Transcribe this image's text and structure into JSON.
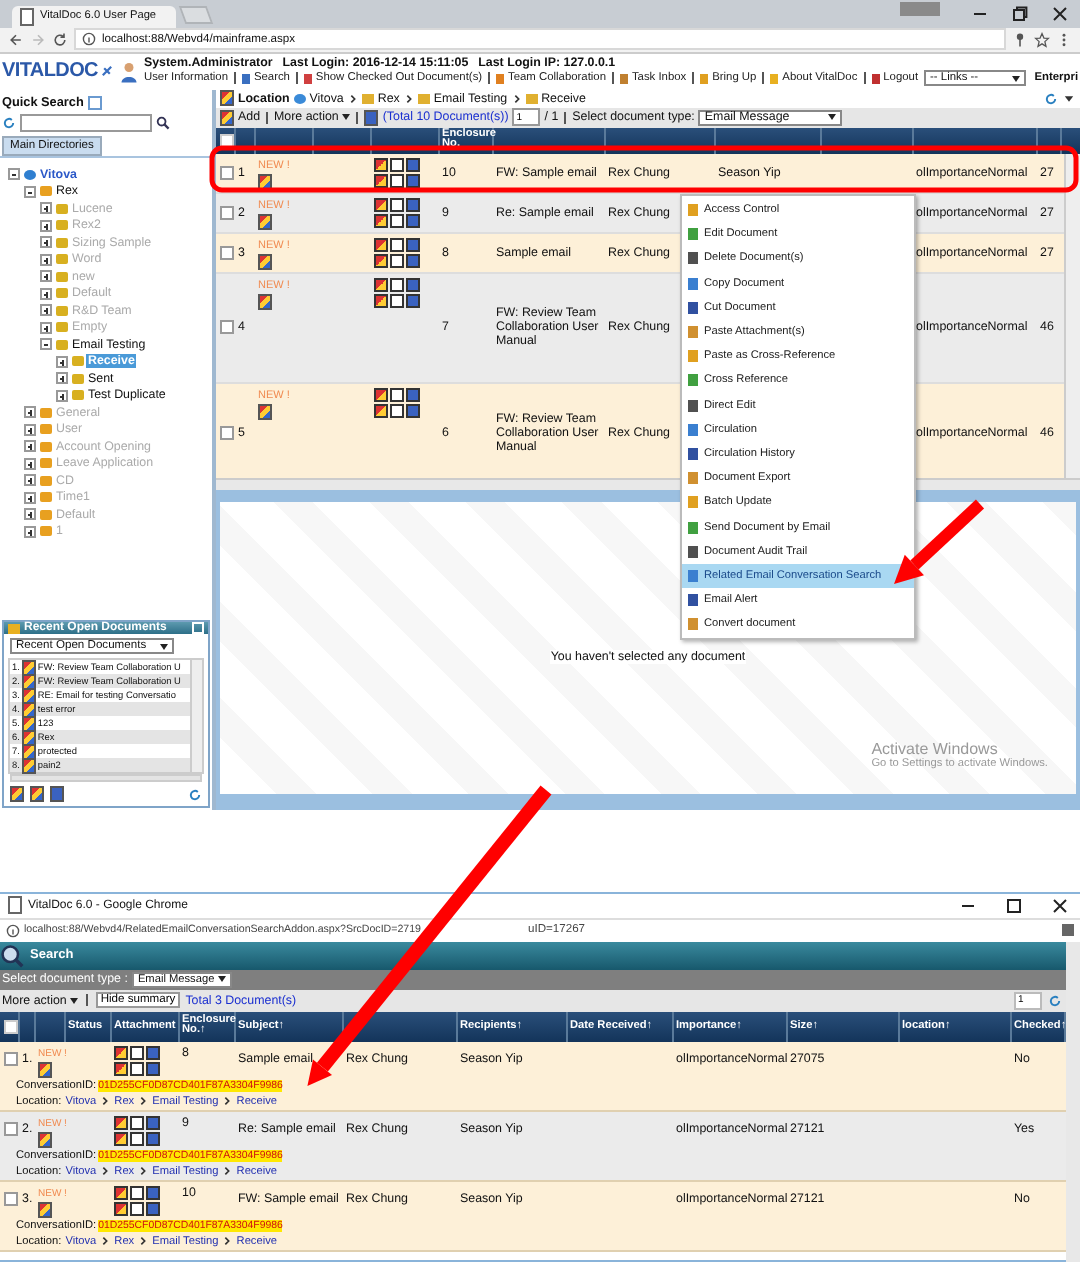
{
  "browser": {
    "tab_title": "VitalDoc 6.0 User Page",
    "url": "localhost:88/Webvd4/mainframe.aspx"
  },
  "header": {
    "logo": "VITALDOC",
    "user": "System.Administrator",
    "last_login": "Last Login: 2016-12-14 15:11:05",
    "last_ip": "Last Login IP: 127.0.0.1",
    "links": [
      "User Information",
      "Search",
      "Show Checked Out Document(s)",
      "Team Collaboration",
      "Task Inbox",
      "Bring Up",
      "About VitalDoc",
      "Logout"
    ],
    "links_select": "-- Links --",
    "edge_text": "Enterpri"
  },
  "sidebar": {
    "quick_search_label": "Quick Search",
    "tab": "Main Directories",
    "tree": [
      {
        "label": "Vitova",
        "kind": "root",
        "dimmed": false,
        "selected": false,
        "expanded": true,
        "children": [
          {
            "label": "Rex",
            "kind": "cabinet",
            "dimmed": false,
            "selected": false,
            "expanded": true,
            "children": [
              {
                "label": "Lucene",
                "kind": "folder",
                "dimmed": true,
                "selected": false,
                "expanded": false
              },
              {
                "label": "Rex2",
                "kind": "folder",
                "dimmed": true,
                "selected": false,
                "expanded": false
              },
              {
                "label": "Sizing Sample",
                "kind": "folder",
                "dimmed": true,
                "selected": false,
                "expanded": false
              },
              {
                "label": "Word",
                "kind": "folder",
                "dimmed": true,
                "selected": false,
                "expanded": false
              },
              {
                "label": "new",
                "kind": "folder",
                "dimmed": true,
                "selected": false,
                "expanded": false
              },
              {
                "label": "Default",
                "kind": "folder",
                "dimmed": true,
                "selected": false,
                "expanded": false
              },
              {
                "label": "R&D Team",
                "kind": "folder",
                "dimmed": true,
                "selected": false,
                "expanded": false
              },
              {
                "label": "Empty",
                "kind": "folder",
                "dimmed": true,
                "selected": false,
                "expanded": false
              },
              {
                "label": "Email Testing",
                "kind": "folder",
                "dimmed": false,
                "selected": false,
                "expanded": true,
                "children": [
                  {
                    "label": "Receive",
                    "kind": "folder",
                    "dimmed": false,
                    "selected": true,
                    "expanded": false
                  },
                  {
                    "label": "Sent",
                    "kind": "folder",
                    "dimmed": false,
                    "selected": false,
                    "expanded": false
                  },
                  {
                    "label": "Test Duplicate",
                    "kind": "folder",
                    "dimmed": false,
                    "selected": false,
                    "expanded": false
                  }
                ]
              }
            ]
          },
          {
            "label": "General",
            "kind": "cabinet",
            "dimmed": true,
            "selected": false,
            "expanded": false
          },
          {
            "label": "User",
            "kind": "cabinet",
            "dimmed": true,
            "selected": false,
            "expanded": false
          },
          {
            "label": "Account Opening",
            "kind": "cabinet",
            "dimmed": true,
            "selected": false,
            "expanded": false
          },
          {
            "label": "Leave Application",
            "kind": "cabinet",
            "dimmed": true,
            "selected": false,
            "expanded": false
          },
          {
            "label": "CD",
            "kind": "cabinet",
            "dimmed": true,
            "selected": false,
            "expanded": false
          },
          {
            "label": "Time1",
            "kind": "cabinet",
            "dimmed": true,
            "selected": false,
            "expanded": false
          },
          {
            "label": "Default",
            "kind": "cabinet",
            "dimmed": true,
            "selected": false,
            "expanded": false
          },
          {
            "label": "1",
            "kind": "cabinet",
            "dimmed": true,
            "selected": false,
            "expanded": false
          }
        ]
      }
    ],
    "recent": {
      "title": "Recent Open Documents",
      "select": "Recent Open Documents",
      "items": [
        {
          "num": "1.",
          "title": "FW: Review Team Collaboration U"
        },
        {
          "num": "2.",
          "title": "FW: Review Team Collaboration U"
        },
        {
          "num": "3.",
          "title": "RE: Email for testing Conversatio"
        },
        {
          "num": "4.",
          "title": "test error"
        },
        {
          "num": "5.",
          "title": "123"
        },
        {
          "num": "6.",
          "title": "Rex"
        },
        {
          "num": "7.",
          "title": "protected"
        },
        {
          "num": "8.",
          "title": "pain2"
        }
      ]
    }
  },
  "main": {
    "location_label": "Location",
    "breadcrumb": [
      "Vitova",
      "Rex",
      "Email Testing",
      "Receive"
    ],
    "toolbar": {
      "add": "Add",
      "more": "More action",
      "total": "(Total 10 Document(s))",
      "page": "1",
      "pages": "/ 1",
      "doctype_label": "Select document type:",
      "doctype": "Email Message"
    },
    "enclosure_header": "Enclosure No.",
    "select_all_checked": false,
    "rows": [
      {
        "checked": false,
        "num": "1",
        "badge": "NEW !",
        "enclosure": "10",
        "subject": "FW: Sample email",
        "sender": "Rex Chung",
        "recipient": "Season Yip",
        "importance": "olImportanceNormal",
        "size": "27"
      },
      {
        "checked": false,
        "num": "2",
        "badge": "NEW !",
        "enclosure": "9",
        "subject": "Re: Sample email",
        "sender": "Rex Chung",
        "importance": "olImportanceNormal",
        "size": "27"
      },
      {
        "checked": false,
        "num": "3",
        "badge": "NEW !",
        "enclosure": "8",
        "subject": "Sample email",
        "sender": "Rex Chung",
        "importance": "olImportanceNormal",
        "size": "27"
      },
      {
        "checked": false,
        "num": "4",
        "badge": "NEW !",
        "enclosure": "7",
        "subject": "FW: Review Team Collaboration User Manual",
        "sender": "Rex Chung",
        "importance": "olImportanceNormal",
        "size": "46"
      },
      {
        "checked": false,
        "num": "5",
        "badge": "NEW !",
        "enclosure": "6",
        "subject": "FW: Review Team Collaboration User Manual",
        "sender": "Rex Chung",
        "importance": "olImportanceNormal",
        "size": "46"
      }
    ],
    "context_menu": [
      {
        "label": "Access Control",
        "selected": false
      },
      {
        "label": "Edit Document",
        "selected": false
      },
      {
        "label": "Delete Document(s)",
        "selected": false
      },
      {
        "label": "Copy Document",
        "selected": false
      },
      {
        "label": "Cut Document",
        "selected": false
      },
      {
        "label": "Paste Attachment(s)",
        "selected": false
      },
      {
        "label": "Paste as Cross-Reference",
        "selected": false
      },
      {
        "label": "Cross Reference",
        "selected": false
      },
      {
        "label": "Direct Edit",
        "selected": false
      },
      {
        "label": "Circulation",
        "selected": false
      },
      {
        "label": "Circulation History",
        "selected": false
      },
      {
        "label": "Document Export",
        "selected": false
      },
      {
        "label": "Batch Update",
        "selected": false
      },
      {
        "label": "Send Document by Email",
        "selected": false
      },
      {
        "label": "Document Audit Trail",
        "selected": false
      },
      {
        "label": "Related Email Conversation Search",
        "selected": true
      },
      {
        "label": "Email Alert",
        "selected": false
      },
      {
        "label": "Convert document",
        "selected": false
      }
    ],
    "preview_message": "You haven't selected any document"
  },
  "os_notice": {
    "title": "Activate Windows",
    "subtitle": "Go to Settings to activate Windows."
  },
  "popup": {
    "window_title": "VitalDoc 6.0 - Google Chrome",
    "url_start": "localhost:88/Webvd4/RelatedEmailConversationSearchAddon.aspx?SrcDocID=2719",
    "url_end": "uID=17267",
    "panel_title": "Search",
    "doctype_label": "Select document type :",
    "doctype": "Email Message",
    "more": "More action",
    "hide": "Hide summary",
    "total": "Total 3 Document(s)",
    "page": "1",
    "select_all_checked": false,
    "headers": [
      "Status",
      "Attachment",
      "Enclosure No.↑",
      "Subject↑",
      "Recipients↑",
      "Date Received↑",
      "Importance↑",
      "Size↑",
      "location↑",
      "Checked↑"
    ],
    "rows": [
      {
        "checked": false,
        "num": "1.",
        "badge": "NEW !",
        "enclosure": "8",
        "subject": "Sample email",
        "sender": "Rex Chung",
        "recipient": "Season Yip",
        "importance": "olImportanceNormal",
        "size": "27075",
        "checked_out": "No",
        "conversation_label": "ConversationID:",
        "conversation_id": "01D255CF0D87CD401F87A3304F9986",
        "location_label": "Location:",
        "location": [
          "Vitova",
          "Rex",
          "Email Testing",
          "Receive"
        ]
      },
      {
        "checked": false,
        "num": "2.",
        "badge": "NEW !",
        "enclosure": "9",
        "subject": "Re: Sample email",
        "sender": "Rex Chung",
        "recipient": "Season Yip",
        "importance": "olImportanceNormal",
        "size": "27121",
        "checked_out": "Yes",
        "conversation_label": "ConversationID:",
        "conversation_id": "01D255CF0D87CD401F87A3304F9986",
        "location_label": "Location:",
        "location": [
          "Vitova",
          "Rex",
          "Email Testing",
          "Receive"
        ]
      },
      {
        "checked": false,
        "num": "3.",
        "badge": "NEW !",
        "enclosure": "10",
        "subject": "FW: Sample email",
        "sender": "Rex Chung",
        "recipient": "Season Yip",
        "importance": "olImportanceNormal",
        "size": "27121",
        "checked_out": "No",
        "conversation_label": "ConversationID:",
        "conversation_id": "01D255CF0D87CD401F87A3304F9986",
        "location_label": "Location:",
        "location": [
          "Vitova",
          "Rex",
          "Email Testing",
          "Receive"
        ]
      }
    ]
  }
}
